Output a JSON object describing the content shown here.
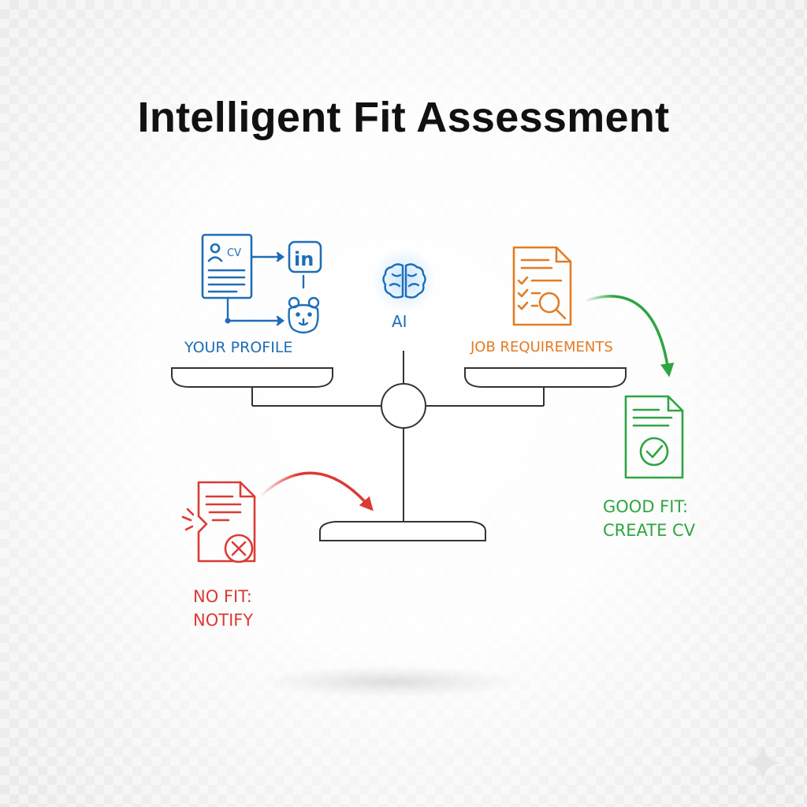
{
  "title": "Intelligent Fit Assessment",
  "profile": {
    "label": "YOUR PROFILE",
    "cv_text": "CV",
    "linkedin_text": "in",
    "icons": [
      "cv-document-icon",
      "linkedin-icon",
      "animal-mascot-icon"
    ],
    "color": "#1f6db8"
  },
  "ai": {
    "label": "AI",
    "icon": "brain-icon",
    "color": "#1f6db8"
  },
  "job": {
    "label": "JOB REQUIREMENTS",
    "icon": "checklist-search-document-icon",
    "color": "#e47b23"
  },
  "good_fit": {
    "line1": "GOOD FIT:",
    "line2": "CREATE CV",
    "icon": "checkmark-document-icon",
    "color": "#2ea542"
  },
  "no_fit": {
    "line1": "NO FIT:",
    "line2": "NOTIFY",
    "icon": "cross-document-icon",
    "color": "#dc3a33"
  }
}
